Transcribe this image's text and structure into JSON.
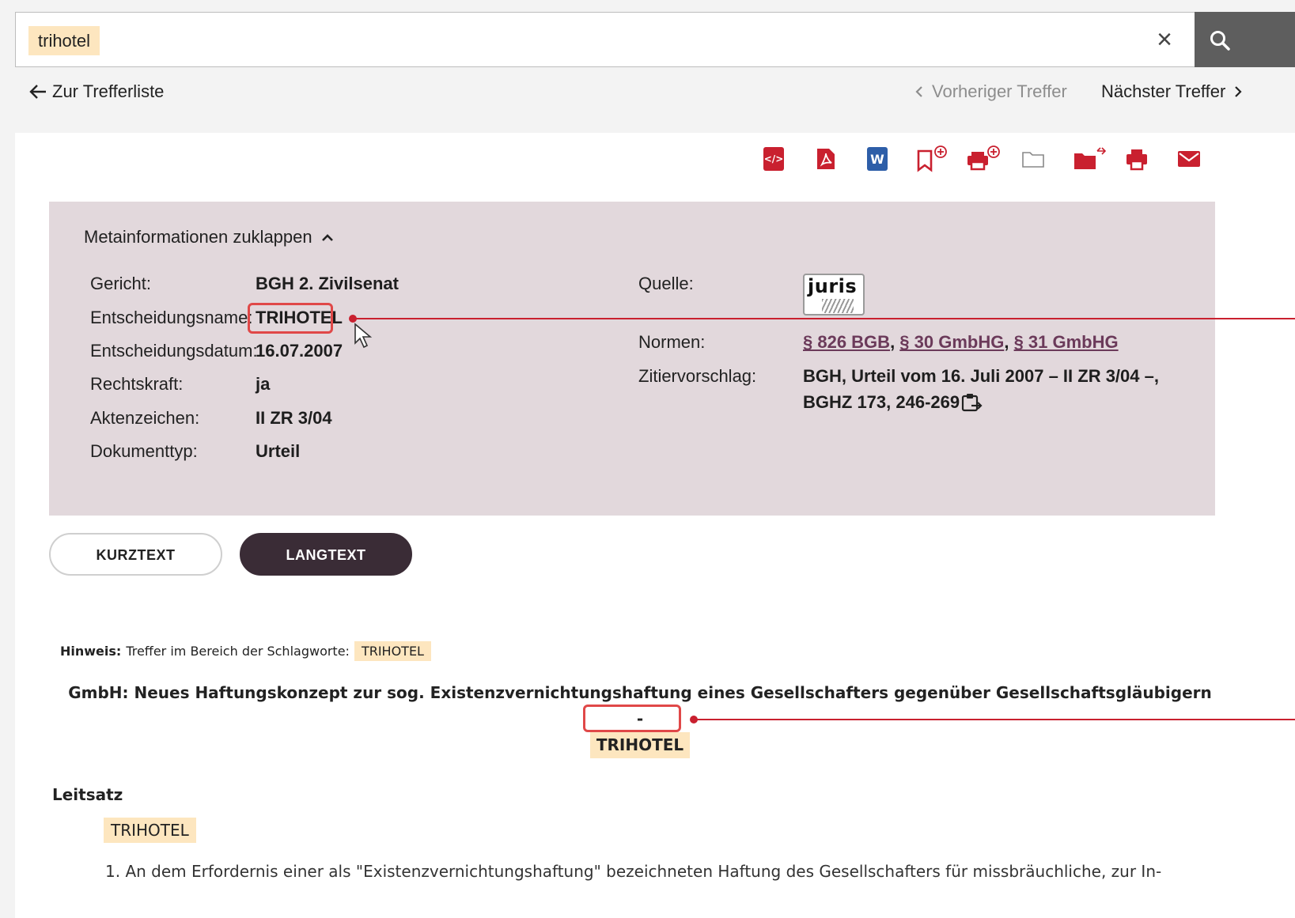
{
  "search": {
    "query": "trihotel",
    "clear_icon": "close-icon",
    "submit_icon": "search-icon"
  },
  "nav": {
    "back_label": "Zur Trefferliste",
    "prev_label": "Vorheriger Treffer",
    "next_label": "Nächster Treffer"
  },
  "toolbar": {
    "icons": [
      "xml-file-icon",
      "pdf-file-icon",
      "word-file-icon",
      "bookmark-add-icon",
      "print-add-icon",
      "folder-icon",
      "folder-move-icon",
      "print-icon",
      "mail-icon"
    ],
    "xml_text": "</>",
    "word_text": "W"
  },
  "meta": {
    "toggle_label": "Metainformationen zuklappen",
    "fields": {
      "gericht_label": "Gericht:",
      "gericht_value": "BGH 2. Zivilsenat",
      "name_label": "Entscheidungsname:",
      "name_value": "TRIHOTEL",
      "datum_label": "Entscheidungsdatum:",
      "datum_value": "16.07.2007",
      "rechtskraft_label": "Rechtskraft:",
      "rechtskraft_value": "ja",
      "aktenzeichen_label": "Aktenzeichen:",
      "aktenzeichen_value": "II ZR 3/04",
      "dokumenttyp_label": "Dokumenttyp:",
      "dokumenttyp_value": "Urteil"
    },
    "quelle_label": "Quelle:",
    "quelle_logo_text": "juris",
    "normen_label": "Normen:",
    "normen": [
      "§ 826 BGB",
      "§ 30 GmbHG",
      "§ 31 GmbHG"
    ],
    "normen_sep": ", ",
    "zitier_label": "Zitiervorschlag:",
    "zitier_line1": "BGH, Urteil vom 16. Juli 2007 – II ZR 3/04 –,",
    "zitier_line2": "BGHZ 173, 246-269"
  },
  "tabs": {
    "kurz": "KURZTEXT",
    "lang": "LANGTEXT",
    "active": "LANGTEXT"
  },
  "content": {
    "hint_label": "Hinweis:",
    "hint_text": "Treffer im Bereich der Schlagworte:",
    "hint_chip": "TRIHOTEL",
    "headline": "GmbH: Neues Haftungskonzept zur sog. Existenzvernichtungshaftung eines Gesellschafters gegenüber Gesellschaftsgläubigern -",
    "headline_chip": "TRIHOTEL",
    "section_title": "Leitsatz",
    "leitsatz_chip": "TRIHOTEL",
    "leitsatz_text": "1. An dem Erfordernis einer als \"Existenzvernichtungshaftung\" bezeichneten Haftung des Gesellschafters für missbräuchliche, zur In-"
  },
  "colors": {
    "accent": "#c9202f",
    "highlight": "#fde6bf",
    "meta_bg": "#e2d8dc",
    "active_tab": "#3a2c36",
    "link": "#6b3a5a"
  }
}
